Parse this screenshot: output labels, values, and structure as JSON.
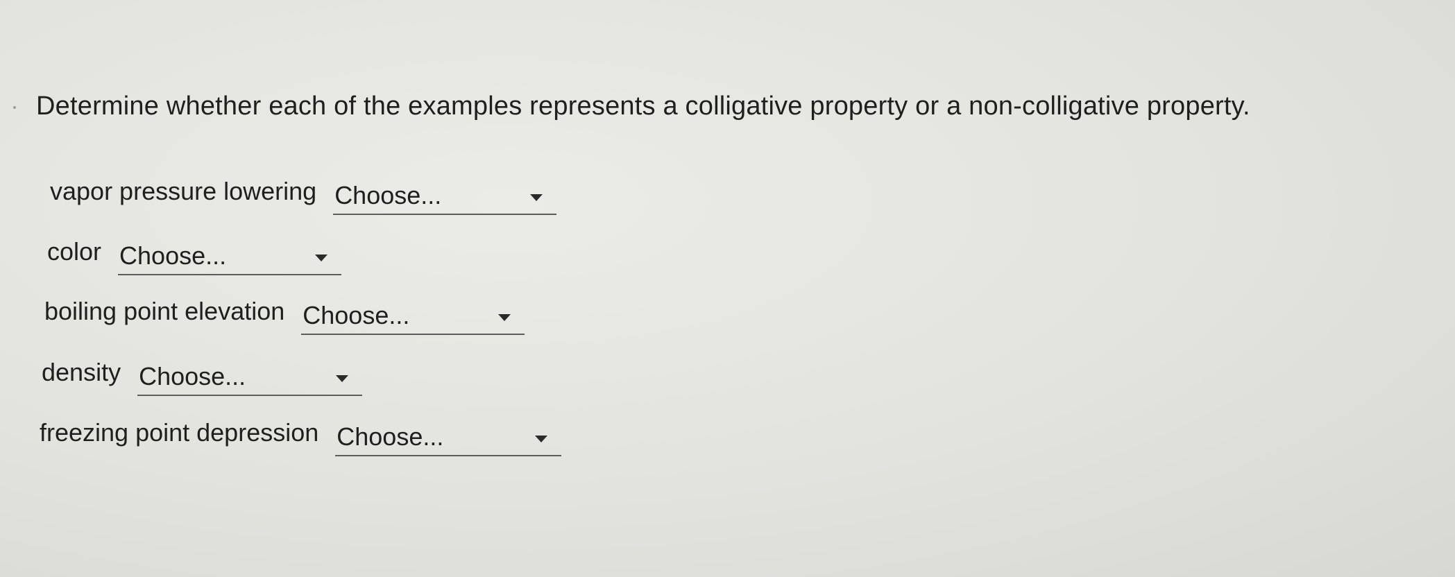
{
  "question": {
    "text": "Determine whether each of the examples represents a colligative property or a non-colligative property."
  },
  "items": [
    {
      "label": "vapor pressure lowering",
      "value": "Choose...",
      "icon": "chevron-down-icon"
    },
    {
      "label": "color",
      "value": "Choose...",
      "icon": "chevron-down-icon"
    },
    {
      "label": "boiling point elevation",
      "value": "Choose...",
      "icon": "chevron-down-icon"
    },
    {
      "label": "density",
      "value": "Choose...",
      "icon": "chevron-down-icon"
    },
    {
      "label": "freezing point depression",
      "value": "Choose...",
      "icon": "chevron-down-icon"
    }
  ]
}
